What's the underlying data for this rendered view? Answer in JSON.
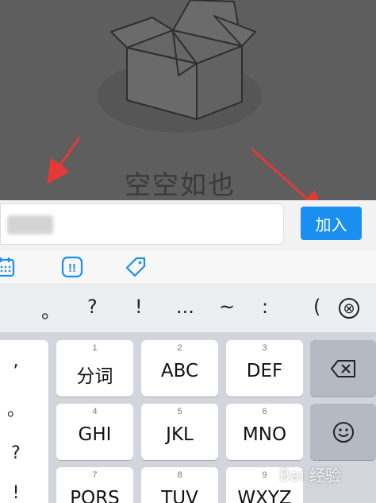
{
  "empty_state": {
    "text": "空空如也",
    "box_icon": "empty-box-icon"
  },
  "input": {
    "value": "",
    "placeholder": ""
  },
  "join_button": {
    "label": "加入",
    "color": "#1a8ff0"
  },
  "toolbar": {
    "icons": [
      "calendar-icon",
      "priority-icon",
      "tag-icon"
    ],
    "priority_glyph": "!!"
  },
  "keyboard": {
    "punct_row": [
      "。",
      "?",
      "!",
      "...",
      "~",
      ":",
      "("
    ],
    "punct_close": "⊗",
    "side_punct": [
      ",",
      "。",
      "?",
      "!"
    ],
    "keys": [
      {
        "num": "1",
        "label": "分词"
      },
      {
        "num": "2",
        "label": "ABC"
      },
      {
        "num": "3",
        "label": "DEF"
      },
      {
        "num": "4",
        "label": "GHI"
      },
      {
        "num": "5",
        "label": "JKL"
      },
      {
        "num": "6",
        "label": "MNO"
      },
      {
        "num": "7",
        "label": "PQRS"
      },
      {
        "num": "8",
        "label": "TUV"
      },
      {
        "num": "9",
        "label": "WXYZ"
      }
    ],
    "fn_keys": [
      "backspace-icon",
      "emoji-icon"
    ]
  },
  "watermark": {
    "text": "Bai 经验"
  }
}
